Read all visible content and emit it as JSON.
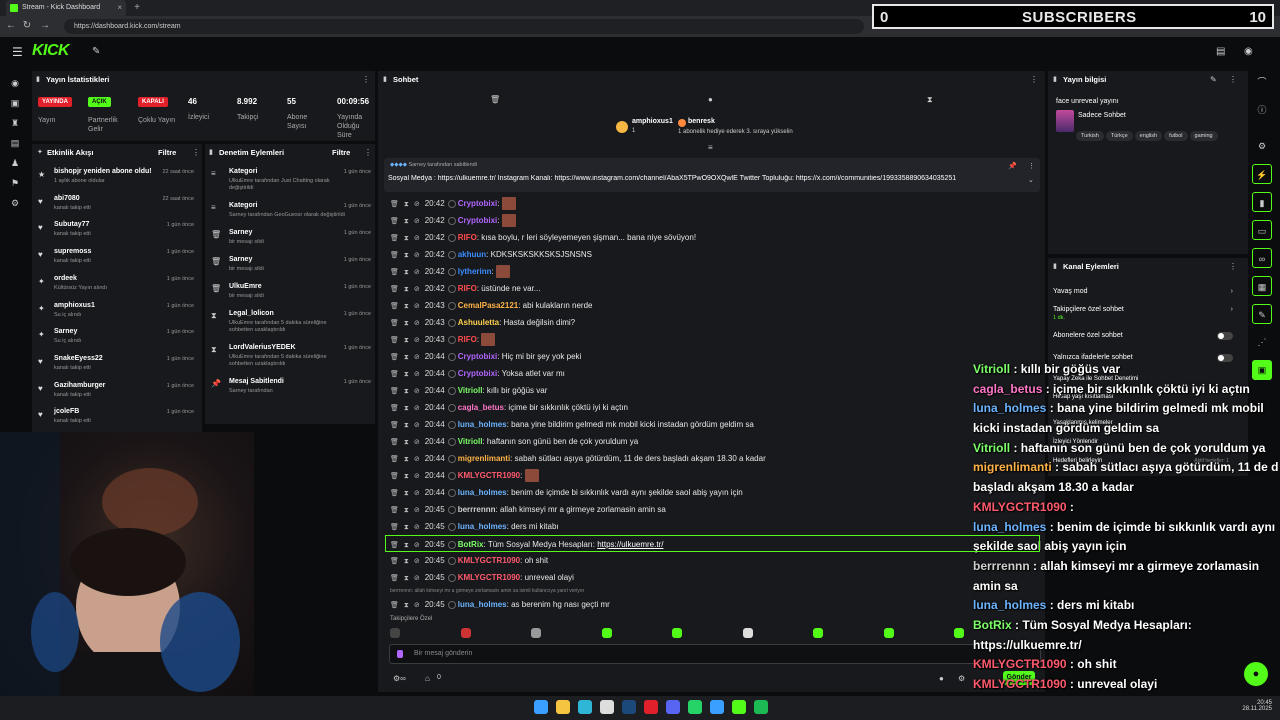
{
  "browser": {
    "tab_title": "Stream - Kick Dashboard",
    "url": "https://dashboard.kick.com/stream"
  },
  "overlay_subs": {
    "left": "0",
    "label": "SUBSCRIBERS",
    "right": "10"
  },
  "logo": "KICK",
  "stats": {
    "title": "Yayın İstatistikleri",
    "items": [
      {
        "badge": "YAYINDA",
        "label": "Yayın",
        "color": "#e0202a"
      },
      {
        "badge": "AÇIK",
        "label": "Partnerlik Gelir",
        "color": "#53fc18"
      },
      {
        "badge": "KAPALI",
        "label": "Çoklu Yayın",
        "color": "#e0202a"
      },
      {
        "value": "46",
        "label": "İzleyici"
      },
      {
        "value": "8.992",
        "label": "Takipçi"
      },
      {
        "value": "55",
        "label": "Abone Sayısı"
      },
      {
        "value": "00:09:56",
        "label": "Yayında Olduğu Süre"
      }
    ]
  },
  "activity": {
    "title": "Etkinlik Akışı",
    "filter": "Filtre",
    "items": [
      {
        "name": "bishopjr yeniden abone oldu!",
        "sub": "1 aylık abone oldular",
        "time": "22 saat önce",
        "icon": "★"
      },
      {
        "name": "abi7080",
        "sub": "kanalı takip etti",
        "time": "22 saat önce",
        "icon": "♥"
      },
      {
        "name": "Subutay77",
        "sub": "kanalı takip etti",
        "time": "1 gün önce",
        "icon": "♥"
      },
      {
        "name": "supremoss",
        "sub": "kanalı takip etti",
        "time": "1 gün önce",
        "icon": "♥"
      },
      {
        "name": "ordeek",
        "sub": "Kültürsüz Yayın alındı",
        "time": "1 gün önce",
        "icon": "✦"
      },
      {
        "name": "amphioxus1",
        "sub": "Su iç alındı",
        "time": "1 gün önce",
        "icon": "✦"
      },
      {
        "name": "Sarney",
        "sub": "Su iç alındı",
        "time": "1 gün önce",
        "icon": "✦"
      },
      {
        "name": "SnakeEyess22",
        "sub": "kanalı takip etti",
        "time": "1 gün önce",
        "icon": "♥"
      },
      {
        "name": "Gazihamburger",
        "sub": "kanalı takip etti",
        "time": "1 gün önce",
        "icon": "♥"
      },
      {
        "name": "jcoleFB",
        "sub": "kanalı takip etti",
        "time": "1 gün önce",
        "icon": "♥"
      }
    ]
  },
  "modlog": {
    "title": "Denetim Eylemleri",
    "filter": "Filtre",
    "items": [
      {
        "name": "Kategori",
        "sub": "UlkuEmre tarafından Just Chatting olarak değiştirildi",
        "time": "1 gün önce",
        "icon": "≡"
      },
      {
        "name": "Kategori",
        "sub": "Sarney tarafından GeoGuessr olarak değiştirildi",
        "time": "1 gün önce",
        "icon": "≡"
      },
      {
        "name": "Sarney",
        "sub": "bir mesajı sildi",
        "time": "1 gün önce",
        "icon": "🗑"
      },
      {
        "name": "Sarney",
        "sub": "bir mesajı sildi",
        "time": "1 gün önce",
        "icon": "🗑"
      },
      {
        "name": "UlkuEmre",
        "sub": "bir mesajı sildi",
        "time": "1 gün önce",
        "icon": "🗑"
      },
      {
        "name": "Legal_lolicon",
        "sub": "UlkuEmre tarafından 5 dakika süreliğine sohbetten uzaklaştırıldı",
        "time": "1 gün önce",
        "icon": "⧗"
      },
      {
        "name": "LordValeriusYEDEK",
        "sub": "UlkuEmre tarafından 5 dakika süreliğine sohbetten uzaklaştırıldı",
        "time": "1 gün önce",
        "icon": "⧗"
      },
      {
        "name": "Mesaj Sabitlendi",
        "sub": "Sarney tarafından",
        "time": "1 gün önce",
        "icon": "📌"
      }
    ]
  },
  "chat": {
    "title": "Sohbet",
    "top_users": [
      {
        "name": "amphioxus1",
        "sub": "1"
      },
      {
        "name": "benresk",
        "sub": "1 abonelik hediye ederek 3. sıraya yükselin"
      }
    ],
    "pinned_by": "Sarney tarafından sabitlendi",
    "pinned_text": "Sosyal Medya : https://ulkuemre.tr/ Instagram Kanalı: https://www.instagram.com/channel/AbaX5TPwO9OXQwlE Twitter Topluluğu: https://x.com/i/communities/1993358890634035251",
    "messages": [
      {
        "time": "20:42",
        "user": "Cryptobixi",
        "msg": "",
        "color": "#b266ff",
        "emote": true
      },
      {
        "time": "20:42",
        "user": "Cryptobixi",
        "msg": "",
        "color": "#b266ff",
        "emote": true
      },
      {
        "time": "20:42",
        "user": "RIFO",
        "msg": "kısa boylu, r leri söyleyemeyen şişman... bana niye sövüyon!",
        "color": "#ff4d4d"
      },
      {
        "time": "20:42",
        "user": "akhuun",
        "msg": "KDKSKSKSKKSKSJSNSNS",
        "color": "#3a8dff"
      },
      {
        "time": "20:42",
        "user": "lytherinn",
        "msg": "",
        "color": "#3a8dff",
        "emote": true
      },
      {
        "time": "20:42",
        "user": "RIFO",
        "msg": "üstünde ne var...",
        "color": "#ff4d4d"
      },
      {
        "time": "20:43",
        "user": "CemalPasa2121",
        "msg": "abi kulakların nerde",
        "color": "#ffb347"
      },
      {
        "time": "20:43",
        "user": "Ashuuletta",
        "msg": "Hasta değilsin dimi?",
        "color": "#ffd24d"
      },
      {
        "time": "20:43",
        "user": "RIFO",
        "msg": "",
        "color": "#ff4d4d",
        "emote": true
      },
      {
        "time": "20:44",
        "user": "Cryptobixi",
        "msg": "Hiç mi bir şey yok peki",
        "color": "#b266ff"
      },
      {
        "time": "20:44",
        "user": "Cryptobixi",
        "msg": "Yoksa atlet var mı",
        "color": "#b266ff"
      },
      {
        "time": "20:44",
        "user": "Vitrioll",
        "msg": "kıllı bir göğüs var",
        "color": "#7dff6a"
      },
      {
        "time": "20:44",
        "user": "cagla_betus",
        "msg": "içime bir sıkkınlık çöktü iyi ki açtın",
        "color": "#ff77c8"
      },
      {
        "time": "20:44",
        "user": "luna_holmes",
        "msg": "bana yine bildirim gelmedi mk mobil kicki instadan gördüm geldim sa",
        "color": "#6cb4ff"
      },
      {
        "time": "20:44",
        "user": "Vitrioll",
        "msg": "haftanın son günü ben de çok yoruldum ya",
        "color": "#7dff6a"
      },
      {
        "time": "20:44",
        "user": "migrenlimanti",
        "msg": "sabah sütlacı aşıya götürdüm, 11 de ders başladı akşam 18.30 a kadar",
        "color": "#ffb347"
      },
      {
        "time": "20:44",
        "user": "KMLYGCTR1090",
        "msg": "",
        "color": "#ff5a6e",
        "emote": true
      },
      {
        "time": "20:44",
        "user": "luna_holmes",
        "msg": "benim de içimde bi sıkkınlık vardı aynı şekilde saol abiş yayın için",
        "color": "#6cb4ff"
      },
      {
        "time": "20:45",
        "user": "berrrennn",
        "msg": "allah kimseyi mr a girmeye zorlamasin amin sa",
        "color": "#cfcfcf"
      },
      {
        "time": "20:45",
        "user": "luna_holmes",
        "msg": "ders mi kitabı",
        "color": "#6cb4ff"
      },
      {
        "time": "20:45",
        "user": "BotRix",
        "msg": "Tüm Sosyal Medya Hesapları:",
        "color": "#7dff6a",
        "link": "https://ulkuemre.tr/",
        "highlight": true
      },
      {
        "time": "20:45",
        "user": "KMLYGCTR1090",
        "msg": "oh shit",
        "color": "#ff5a6e"
      },
      {
        "time": "20:45",
        "user": "KMLYGCTR1090",
        "msg": "unreveal olayi",
        "color": "#ff5a6e"
      },
      {
        "time": "20:45",
        "user": "luna_holmes",
        "msg": "as berenim hg nası geçti mr",
        "color": "#6cb4ff",
        "reply": "berrrennn: allah kimseyi mr a girmeye zorlamasin amin sa isimli kullanıcıya yanıt veriyor"
      }
    ],
    "followers_only": "Takipçilere Özel",
    "input_placeholder": "Bir mesaj gönderin",
    "send_label": "Gönder",
    "count": "0"
  },
  "stream_info": {
    "title": "Yayın bilgisi",
    "stream_title": "face unreveal yayını",
    "category": "Sadece Sohbet",
    "tags": [
      "Turkish",
      "Türkçe",
      "english",
      "futbol",
      "gaming"
    ]
  },
  "channel_actions": {
    "title": "Kanal Eylemleri",
    "items": [
      {
        "label": "Yavaş mod",
        "sub": ""
      },
      {
        "label": "Takipçilere özel sohbet",
        "sub": "1 dk."
      },
      {
        "label": "Abonelere özel sohbet",
        "sub": ""
      },
      {
        "label": "Yalnızca ifadelerle sohbet",
        "sub": ""
      },
      {
        "label": "Yapay Zeka ile Sohbet Denetimi",
        "sub": ""
      },
      {
        "label": "Hesap yaşı kısıtlaması",
        "sub": ""
      },
      {
        "label": "Yasaklanmış kelimeler",
        "sub": ""
      },
      {
        "label": "İzleyici Yönlendir",
        "sub": ""
      },
      {
        "label": "Hedefleri belirleyin",
        "sub": "Aktif hedefler: 1"
      }
    ]
  },
  "overlay_chat": [
    {
      "user": "Vitrioll",
      "msg": "kıllı bir göğüs var",
      "color": "#7dff6a"
    },
    {
      "user": "cagla_betus",
      "msg": "içime bir sıkkınlık çöktü iyi ki açtın",
      "color": "#ff77c8"
    },
    {
      "user": "luna_holmes",
      "msg": "bana yine bildirim gelmedi mk mobil",
      "color": "#6cb4ff"
    },
    {
      "user": "",
      "msg": "kicki instadan gördüm geldim sa",
      "color": "#6cb4ff"
    },
    {
      "user": "Vitrioll",
      "msg": "haftanın son günü ben de çok yoruldum ya",
      "color": "#7dff6a"
    },
    {
      "user": "migrenlimanti",
      "msg": "sabah sütlacı aşıya götürdüm, 11 de ders",
      "color": "#ffb347"
    },
    {
      "user": "",
      "msg": "başladı akşam 18.30 a kadar",
      "color": "#ffb347"
    },
    {
      "user": "KMLYGCTR1090",
      "msg": "",
      "color": "#ff5a6e"
    },
    {
      "user": "luna_holmes",
      "msg": "benim de içimde bi sıkkınlık vardı aynı",
      "color": "#6cb4ff"
    },
    {
      "user": "",
      "msg": "şekilde saol abiş yayın için",
      "color": "#6cb4ff"
    },
    {
      "user": "berrrennn",
      "msg": "allah kimseyi mr a girmeye zorlamasin",
      "color": "#cfcfcf"
    },
    {
      "user": "",
      "msg": "amin sa",
      "color": "#cfcfcf"
    },
    {
      "user": "luna_holmes",
      "msg": "ders mi kitabı",
      "color": "#6cb4ff"
    },
    {
      "user": "BotRix",
      "msg": "Tüm Sosyal Medya Hesapları:",
      "color": "#7dff6a"
    },
    {
      "user": "",
      "msg": "https://ulkuemre.tr/",
      "color": "#7dff6a"
    },
    {
      "user": "KMLYGCTR1090",
      "msg": "oh shit",
      "color": "#ff5a6e"
    },
    {
      "user": "KMLYGCTR1090",
      "msg": "unreveal olayi",
      "color": "#ff5a6e"
    },
    {
      "user": "luna_holmes",
      "msg": "as berenim hg nası geçti mr",
      "color": "#6cb4ff"
    }
  ],
  "taskbar": {
    "time": "20:45",
    "date": "28.11.2025"
  }
}
